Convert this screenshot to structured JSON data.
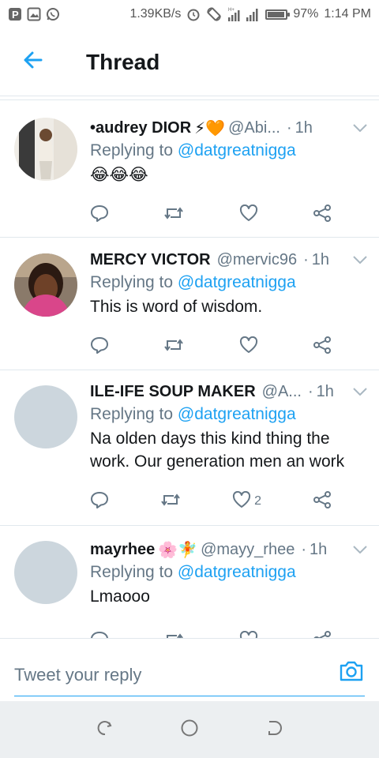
{
  "status_bar": {
    "net_speed": "1.39KB/s",
    "battery": "97%",
    "battery_level": 0.97,
    "time": "1:14 PM",
    "left_icons": [
      "p-icon",
      "image-icon",
      "whatsapp-icon"
    ],
    "right_icons": [
      "alarm-icon",
      "rotate-icon",
      "data-signal-icon",
      "cell-signal-icon"
    ]
  },
  "header": {
    "title": "Thread"
  },
  "tweets": [
    {
      "name": "•audrey DIOR",
      "name_emoji": "⚡🧡",
      "handle": "@Abi...",
      "time": "1h",
      "replying_prefix": "Replying to",
      "replying_to": "@datgreatnigga",
      "text": "😂😂😂",
      "like_count": "",
      "avatar": "photo"
    },
    {
      "name": "MERCY VICTOR",
      "name_emoji": "",
      "handle": "@mervic96",
      "time": "1h",
      "replying_prefix": "Replying to",
      "replying_to": "@datgreatnigga",
      "text": "This is word of wisdom.",
      "like_count": "",
      "avatar": "photo"
    },
    {
      "name": "ILE-IFE SOUP MAKER",
      "name_emoji": "",
      "handle": "@A...",
      "time": "1h",
      "replying_prefix": "Replying to",
      "replying_to": "@datgreatnigga",
      "text": "Na olden days this kind thing the work. Our generation men an work",
      "like_count": "2",
      "avatar": "placeholder"
    },
    {
      "name": "mayrhee",
      "name_emoji": "🌸🧚",
      "handle": "@mayy_rhee",
      "time": "1h",
      "replying_prefix": "Replying to",
      "replying_to": "@datgreatnigga",
      "text": "Lmaooo",
      "like_count": "",
      "avatar": "placeholder"
    }
  ],
  "reply_bar": {
    "placeholder": "Tweet your reply"
  },
  "colors": {
    "accent": "#1da1f2",
    "secondary_text": "#657786",
    "divider": "#e1e8ed",
    "avatar_placeholder": "#ccd6dd"
  }
}
